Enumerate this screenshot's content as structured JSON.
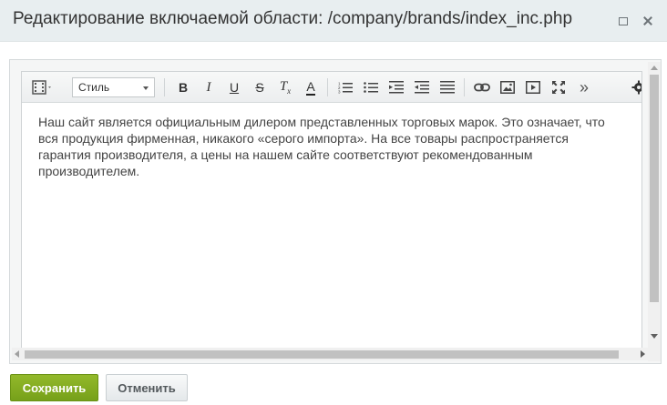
{
  "window": {
    "title": "Редактирование включаемой области: /company/brands/index_inc.php",
    "maximize_icon": "maximize-icon",
    "close_icon": "close-icon"
  },
  "toolbar": {
    "style_select": {
      "selected": "Стиль",
      "icon": "chevron-down-icon"
    },
    "buttons": [
      {
        "name": "view-mode",
        "icon": "film-strip-icon"
      },
      {
        "name": "bold",
        "icon": "bold-icon",
        "glyph": "B"
      },
      {
        "name": "italic",
        "icon": "italic-icon",
        "glyph": "I"
      },
      {
        "name": "underline",
        "icon": "underline-icon",
        "glyph": "U"
      },
      {
        "name": "strikethrough",
        "icon": "strikethrough-icon",
        "glyph": "S"
      },
      {
        "name": "remove-format",
        "icon": "clear-format-icon",
        "glyph": "T"
      },
      {
        "name": "font-color",
        "icon": "font-color-icon",
        "glyph": "A"
      },
      {
        "name": "ordered-list",
        "icon": "ordered-list-icon"
      },
      {
        "name": "unordered-list",
        "icon": "unordered-list-icon"
      },
      {
        "name": "outdent",
        "icon": "outdent-icon"
      },
      {
        "name": "indent",
        "icon": "indent-icon"
      },
      {
        "name": "justify",
        "icon": "align-justify-icon"
      },
      {
        "name": "link",
        "icon": "link-icon"
      },
      {
        "name": "image",
        "icon": "image-icon"
      },
      {
        "name": "video",
        "icon": "video-icon"
      },
      {
        "name": "fullscreen",
        "icon": "fullscreen-icon"
      },
      {
        "name": "more",
        "icon": "more-icon",
        "glyph": "»"
      },
      {
        "name": "settings",
        "icon": "gear-icon"
      }
    ]
  },
  "content": {
    "text": "Наш сайт является официальным дилером представленных торговых марок. Это означает, что вся продукция фирменная, никакого «серого импорта». На все товары распространяется гарантия производителя, а цены на нашем сайте соответствуют рекомендованным производителем."
  },
  "footer": {
    "save_label": "Сохранить",
    "cancel_label": "Отменить"
  },
  "colors": {
    "save_button": "#7ba31e",
    "title_bar": "#e8eef0",
    "text": "#444444"
  }
}
